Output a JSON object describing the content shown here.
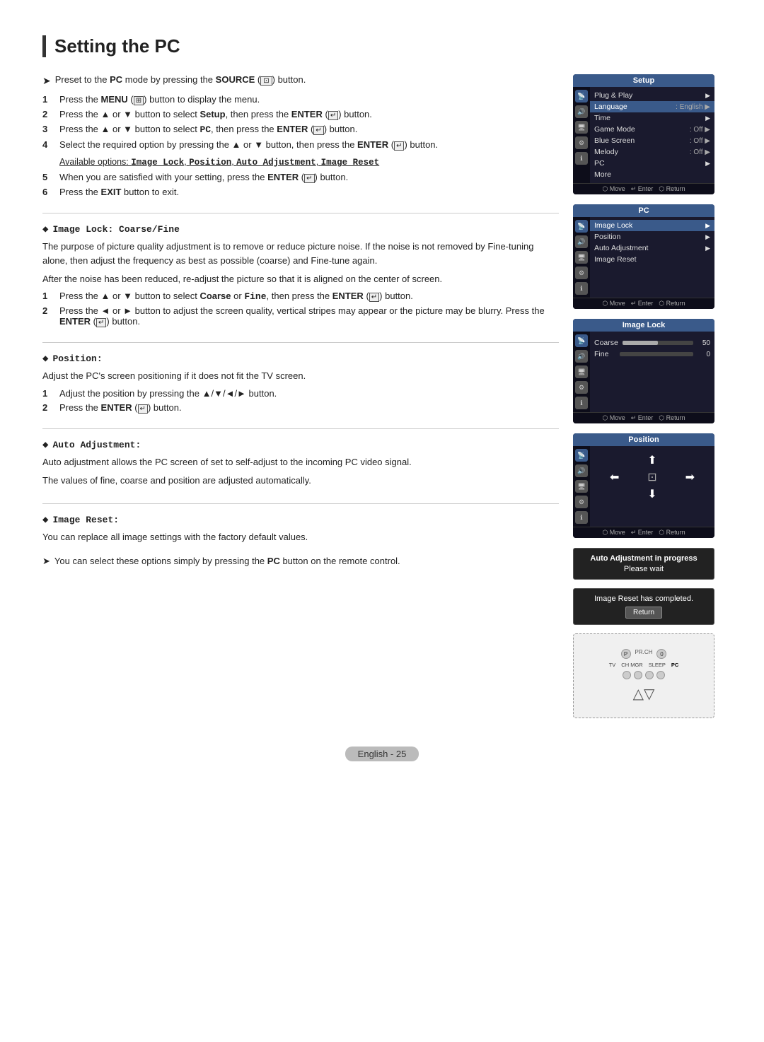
{
  "page": {
    "title": "Setting the PC",
    "footer": "English - 25"
  },
  "intro": {
    "arrow_text": "Preset to the PC mode by pressing the SOURCE (   ) button."
  },
  "steps": [
    {
      "num": "1",
      "text": "Press the MENU (   ) button to display the menu."
    },
    {
      "num": "2",
      "text": "Press the ▲ or ▼ button to select Setup, then press the ENTER (   ) button."
    },
    {
      "num": "3",
      "text": "Press the ▲ or ▼ button to select PC, then press the ENTER (   ) button."
    },
    {
      "num": "4",
      "text": "Select the required option by pressing the ▲ or ▼ button, then press the ENTER (   ) button."
    },
    {
      "num": "5",
      "text": "When you are satisfied with your setting, press the ENTER (   ) button."
    },
    {
      "num": "6",
      "text": "Press the EXIT button to exit."
    }
  ],
  "available_options": "Available options: Image Lock, Position, Auto Adjustment, Image Reset",
  "sections": [
    {
      "id": "image-lock",
      "header": "Image Lock: Coarse/Fine",
      "body": [
        "The purpose of picture quality adjustment is to remove or reduce picture noise. If the noise is not removed by Fine-tuning alone, then adjust the frequency as best as possible (coarse) and Fine-tune again.",
        "After the noise has been reduced, re-adjust the picture so that it is aligned on the center of screen."
      ],
      "sub_steps": [
        {
          "num": "1",
          "text": "Press the ▲ or ▼ button to select Coarse or Fine, then press the ENTER (   ) button."
        },
        {
          "num": "2",
          "text": "Press the ◄ or ► button to adjust the screen quality, vertical stripes may appear or the picture may be blurry. Press the ENTER (   ) button."
        }
      ]
    },
    {
      "id": "position",
      "header": "Position:",
      "body": [
        "Adjust the PC's screen positioning if it does not fit the TV screen."
      ],
      "sub_steps": [
        {
          "num": "1",
          "text": "Adjust the position by pressing the ▲/▼/◄/► button."
        },
        {
          "num": "2",
          "text": "Press the ENTER (   ) button."
        }
      ]
    },
    {
      "id": "auto-adjustment",
      "header": "Auto Adjustment:",
      "body": [
        "Auto adjustment allows the PC screen of set to self-adjust to the incoming PC video signal.",
        "The values of fine, coarse and position are adjusted automatically."
      ],
      "sub_steps": []
    },
    {
      "id": "image-reset",
      "header": "Image Reset:",
      "body": [
        "You can replace all image settings with the factory default values."
      ],
      "sub_steps": []
    }
  ],
  "footer_note": "You can select these options simply by pressing the PC button on the remote control.",
  "setup_menu": {
    "title": "Setup",
    "items": [
      {
        "label": "Plug & Play",
        "value": "",
        "arrow": true
      },
      {
        "label": "Language",
        "value": "English",
        "arrow": true,
        "highlighted": false
      },
      {
        "label": "Time",
        "value": "",
        "arrow": true
      },
      {
        "label": "Game Mode",
        "value": "Off",
        "arrow": true
      },
      {
        "label": "Blue Screen",
        "value": "Off",
        "arrow": true
      },
      {
        "label": "Melody",
        "value": "Off",
        "arrow": true
      },
      {
        "label": "PC",
        "value": "",
        "arrow": true
      },
      {
        "label": "More",
        "value": "",
        "arrow": false
      }
    ],
    "footer": [
      "Move",
      "Enter",
      "Return"
    ]
  },
  "pc_menu": {
    "title": "PC",
    "items": [
      {
        "label": "Image Lock",
        "arrow": true,
        "highlighted": true
      },
      {
        "label": "Position",
        "arrow": true
      },
      {
        "label": "Auto Adjustment",
        "arrow": true
      },
      {
        "label": "Image Reset",
        "arrow": false
      }
    ],
    "footer": [
      "Move",
      "Enter",
      "Return"
    ]
  },
  "image_lock_menu": {
    "title": "Image Lock",
    "items": [
      {
        "label": "Coarse",
        "value": 50,
        "max": 100,
        "highlighted": true
      },
      {
        "label": "Fine",
        "value": 0,
        "max": 100,
        "highlighted": false
      }
    ],
    "footer": [
      "Move",
      "Enter",
      "Return"
    ]
  },
  "position_menu": {
    "title": "Position",
    "footer": [
      "Move",
      "Enter",
      "Return"
    ]
  },
  "auto_adj": {
    "line1": "Auto Adjustment in progress",
    "line2": "Please wait"
  },
  "image_reset": {
    "line1": "Image Reset has completed.",
    "btn": "Return"
  },
  "remote": {
    "labels": [
      "TV",
      "CH MGR",
      "SLEEP",
      "PC"
    ]
  }
}
